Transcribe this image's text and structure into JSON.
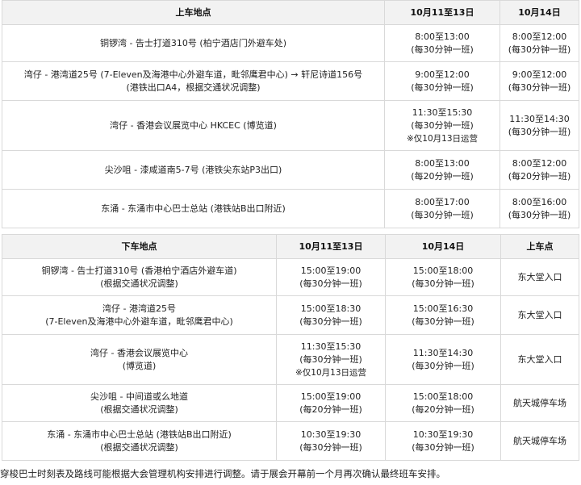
{
  "pickup_table": {
    "headers": [
      "上车地点",
      "10月11至13日",
      "10月14日"
    ],
    "rows": [
      {
        "location": [
          "铜锣湾 - 告士打道310号 (柏宁酒店门外避车处)"
        ],
        "d1": [
          "8:00至13:00",
          "(每30分钟一班)"
        ],
        "d2": [
          "8:00至12:00",
          "(每30分钟一班)"
        ]
      },
      {
        "location": [
          "湾仔 - 港湾道25号 (7-Eleven及海港中心外避车道，毗邻鹰君中心) → 轩尼诗道156号",
          "(港铁出口A4，根据交通状况调整)"
        ],
        "d1": [
          "9:00至12:00",
          "(每30分钟一班)"
        ],
        "d2": [
          "9:00至12:00",
          "(每30分钟一班)"
        ]
      },
      {
        "location": [
          "湾仔 - 香港会议展览中心 HKCEC (博览道)"
        ],
        "d1": [
          "11:30至15:30",
          "(每30分钟一班)",
          "※仅10月13日运营"
        ],
        "d2": [
          "11:30至14:30",
          "(每30分钟一班)"
        ]
      },
      {
        "location": [
          "尖沙咀 - 漆咸道南5-7号 (港铁尖东站P3出口)"
        ],
        "d1": [
          "8:00至13:00",
          "(每20分钟一班)"
        ],
        "d2": [
          "8:00至12:00",
          "(每20分钟一班)"
        ]
      },
      {
        "location": [
          "东涌 - 东涌市中心巴士总站 (港铁站B出口附近)"
        ],
        "d1": [
          "8:00至17:00",
          "(每30分钟一班)"
        ],
        "d2": [
          "8:00至16:00",
          "(每30分钟一班)"
        ]
      }
    ]
  },
  "dropoff_table": {
    "headers": [
      "下车地点",
      "10月11至13日",
      "10月14日",
      "上车点"
    ],
    "rows": [
      {
        "location": [
          "铜锣湾 - 告士打道310号 (香港柏宁酒店外避车道)",
          "(根据交通状况调整)"
        ],
        "d1": [
          "15:00至19:00",
          "(每30分钟一班)"
        ],
        "d2": [
          "15:00至18:00",
          "(每30分钟一班)"
        ],
        "point": "东大堂入口"
      },
      {
        "location": [
          "湾仔 - 港湾道25号",
          "(7-Eleven及海港中心外避车道，毗邻鹰君中心)"
        ],
        "d1": [
          "15:00至18:30",
          "(每30分钟一班)"
        ],
        "d2": [
          "15:00至16:30",
          "(每30分钟一班)"
        ],
        "point": "东大堂入口"
      },
      {
        "location": [
          "湾仔 - 香港会议展览中心",
          "(博览道)"
        ],
        "d1": [
          "11:30至15:30",
          "(每30分钟一班)",
          "※仅10月13日运营"
        ],
        "d2": [
          "11:30至14:30",
          "(每30分钟一班)"
        ],
        "point": "东大堂入口"
      },
      {
        "location": [
          "尖沙咀 - 中间道或么地道",
          "(根据交通状况调整)"
        ],
        "d1": [
          "15:00至19:00",
          "(每20分钟一班)"
        ],
        "d2": [
          "15:00至18:00",
          "(每20分钟一班)"
        ],
        "point": "航天城停车场"
      },
      {
        "location": [
          "东涌 - 东涌市中心巴士总站 (港铁站B出口附近)",
          "(根据交通状况调整)"
        ],
        "d1": [
          "10:30至19:30",
          "(每30分钟一班)"
        ],
        "d2": [
          "10:30至19:30",
          "(每30分钟一班)"
        ],
        "point": "航天城停车场"
      }
    ]
  },
  "footer": "穿梭巴士时刻表及路线可能根据大会管理机构安排进行调整。请于展会开幕前一个月再次确认最终班车安排。"
}
